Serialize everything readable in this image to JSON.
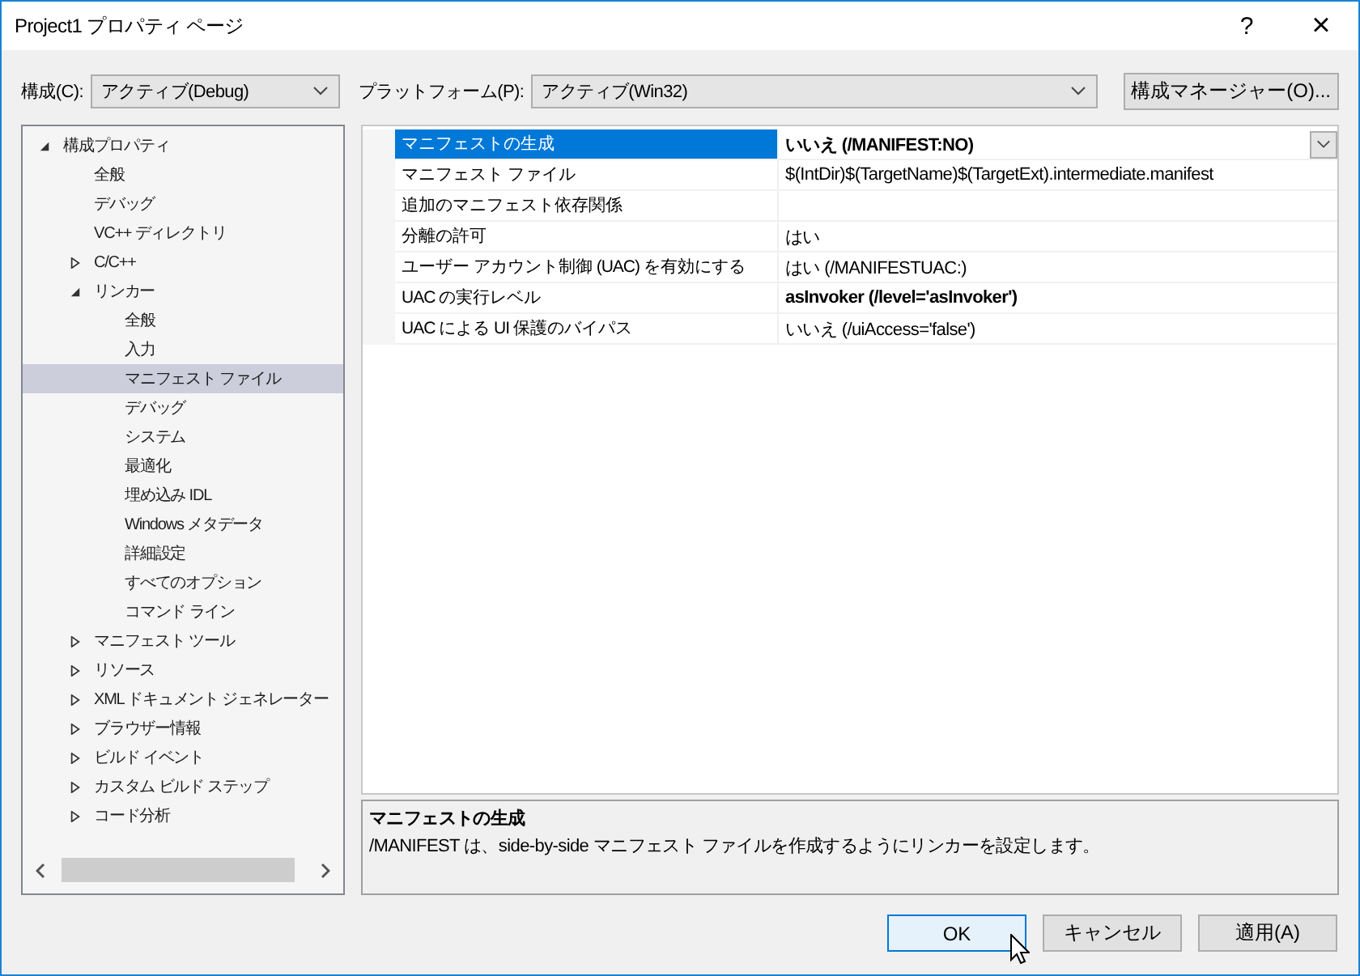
{
  "window": {
    "title": "Project1 プロパティ ページ",
    "help": "?",
    "close": "×"
  },
  "config": {
    "label": "構成(C):",
    "value": "アクティブ(Debug)"
  },
  "platform": {
    "label": "プラットフォーム(P):",
    "value": "アクティブ(Win32)"
  },
  "config_manager": "構成マネージャー(O)...",
  "tree": [
    {
      "label": "構成プロパティ",
      "kind": "group",
      "expanded": true,
      "selected": false,
      "children": [
        {
          "label": "全般",
          "kind": "page",
          "selected": false
        },
        {
          "label": "デバッグ",
          "kind": "page",
          "selected": false
        },
        {
          "label": "VC++ ディレクトリ",
          "kind": "page",
          "selected": false
        },
        {
          "label": "C/C++",
          "kind": "group",
          "expanded": false,
          "selected": false
        },
        {
          "label": "リンカー",
          "kind": "group",
          "expanded": true,
          "selected": false,
          "children": [
            {
              "label": "全般",
              "kind": "page",
              "selected": false
            },
            {
              "label": "入力",
              "kind": "page",
              "selected": false
            },
            {
              "label": "マニフェスト ファイル",
              "kind": "page",
              "selected": true
            },
            {
              "label": "デバッグ",
              "kind": "page",
              "selected": false
            },
            {
              "label": "システム",
              "kind": "page",
              "selected": false
            },
            {
              "label": "最適化",
              "kind": "page",
              "selected": false
            },
            {
              "label": "埋め込み IDL",
              "kind": "page",
              "selected": false
            },
            {
              "label": "Windows メタデータ",
              "kind": "page",
              "selected": false
            },
            {
              "label": "詳細設定",
              "kind": "page",
              "selected": false
            },
            {
              "label": "すべてのオプション",
              "kind": "page",
              "selected": false
            },
            {
              "label": "コマンド ライン",
              "kind": "page",
              "selected": false
            }
          ]
        },
        {
          "label": "マニフェスト ツール",
          "kind": "group",
          "expanded": false,
          "selected": false
        },
        {
          "label": "リソース",
          "kind": "group",
          "expanded": false,
          "selected": false
        },
        {
          "label": "XML ドキュメント ジェネレーター",
          "kind": "group",
          "expanded": false,
          "selected": false
        },
        {
          "label": "ブラウザー情報",
          "kind": "group",
          "expanded": false,
          "selected": false
        },
        {
          "label": "ビルド イベント",
          "kind": "group",
          "expanded": false,
          "selected": false
        },
        {
          "label": "カスタム ビルド ステップ",
          "kind": "group",
          "expanded": false,
          "selected": false
        },
        {
          "label": "コード分析",
          "kind": "group",
          "expanded": false,
          "selected": false
        }
      ]
    }
  ],
  "properties": [
    {
      "name": "マニフェストの生成",
      "value": "いいえ (/MANIFEST:NO)",
      "modified": true,
      "selected": true
    },
    {
      "name": "マニフェスト ファイル",
      "value": "$(IntDir)$(TargetName)$(TargetExt).intermediate.manifest",
      "modified": false,
      "selected": false
    },
    {
      "name": "追加のマニフェスト依存関係",
      "selected": false
    },
    {
      "name": "分離の許可",
      "value": "はい",
      "modified": false,
      "selected": false
    },
    {
      "name": "ユーザー アカウント制御 (UAC) を有効にする",
      "value": "はい (/MANIFESTUAC:)",
      "modified": false,
      "selected": false
    },
    {
      "name": "UAC の実行レベル",
      "value": "asInvoker (/level='asInvoker')",
      "modified": true,
      "selected": false
    },
    {
      "name": "UAC による UI 保護のバイパス",
      "value": "いいえ (/uiAccess='false')",
      "modified": false,
      "selected": false
    }
  ],
  "description": {
    "title": "マニフェストの生成",
    "text": "/MANIFEST は、side-by-side マニフェスト ファイルを作成するようにリンカーを設定します。"
  },
  "buttons": [
    {
      "label": "OK",
      "default": true
    },
    {
      "label": "キャンセル",
      "default": false
    },
    {
      "label": "適用(A)",
      "default": false
    }
  ]
}
